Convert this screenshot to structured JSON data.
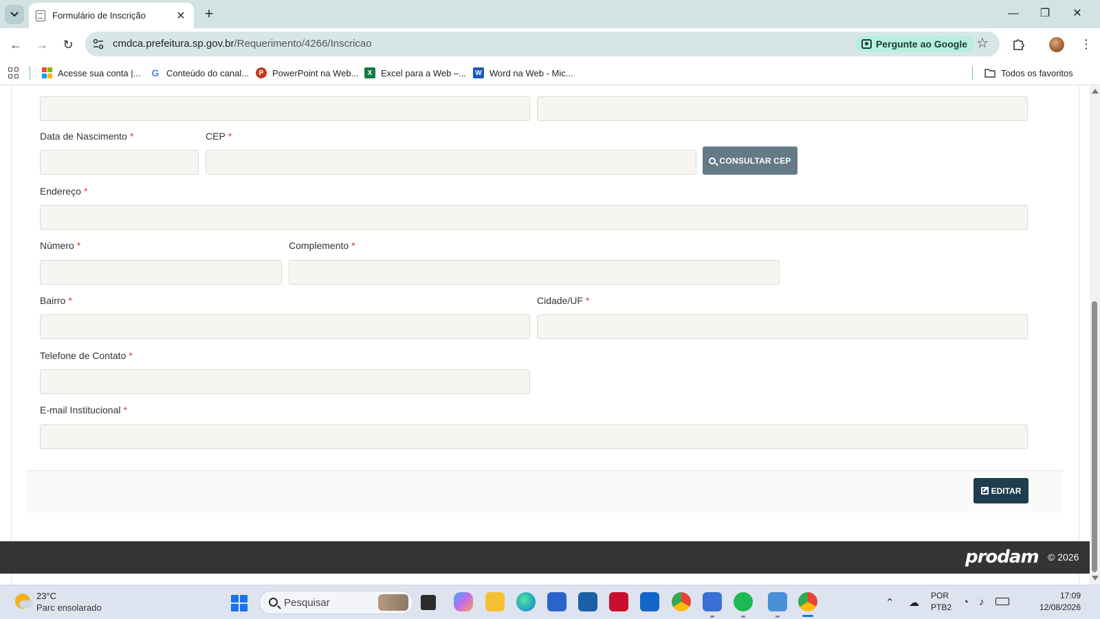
{
  "browser": {
    "tab_title": "Formulário de Inscrição",
    "url_domain": "cmdca.prefeitura.sp.gov.br",
    "url_path": "/Requerimento/4266/Inscricao",
    "ask_google_label": "Pergunte ao Google",
    "bookmarks": [
      {
        "label": "Acesse sua conta |..."
      },
      {
        "label": "Conteúdo do canal..."
      },
      {
        "label": "PowerPoint na Web..."
      },
      {
        "label": "Excel para a Web –..."
      },
      {
        "label": "Word na Web - Mic..."
      }
    ],
    "all_bookmarks_label": "Todos os favoritos"
  },
  "form": {
    "fields": {
      "data_nascimento": "Data de Nascimento",
      "cep": "CEP",
      "endereco": "Endereço",
      "numero": "Número",
      "complemento": "Complemento",
      "bairro": "Bairro",
      "cidade_uf": "Cidade/UF",
      "telefone": "Telefone de Contato",
      "email": "E-mail Institucional"
    },
    "required_marker": "*",
    "consult_cep_button": "CONSULTAR CEP",
    "edit_button": "EDITAR"
  },
  "footer": {
    "brand": "prodam",
    "copyright": "© 2026"
  },
  "taskbar": {
    "temperature": "23°C",
    "condition": "Parc ensolarado",
    "search_placeholder": "Pesquisar",
    "language": "POR",
    "keyboard": "PTB2",
    "time": "17:09",
    "date": "12/08/2026"
  },
  "colors": {
    "required": "#e0312c",
    "consult_button": "#657a87",
    "edit_button": "#1f3d4e",
    "input_bg": "#f7f5f2",
    "footer_bg": "#343434"
  }
}
